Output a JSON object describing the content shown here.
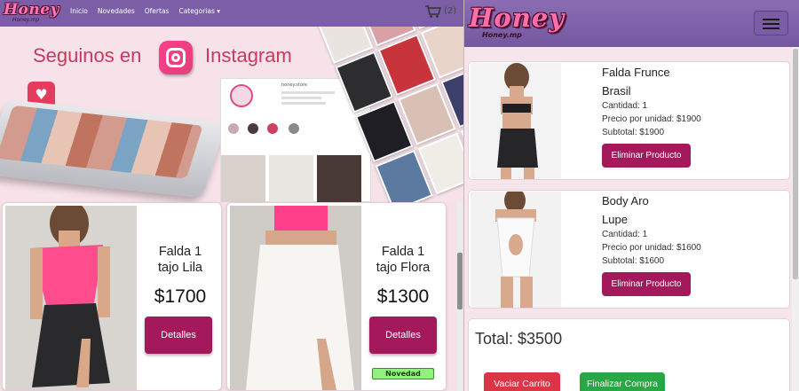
{
  "left": {
    "logo_text": "Honey",
    "logo_subtext": "Honey.mp",
    "nav": {
      "inicio": "Inicio",
      "novedades": "Novedades",
      "ofertas": "Ofertas",
      "categorias": "Categorias ▾"
    },
    "cart_count": "(2)",
    "hero": {
      "text_before": "Seguinos en",
      "text_after": "Instagram",
      "ig_handle": "honey.store"
    },
    "products": [
      {
        "name_line1": "Falda 1",
        "name_line2": "tajo Lila",
        "price": "$1700",
        "button": "Detalles",
        "badge": ""
      },
      {
        "name_line1": "Falda 1",
        "name_line2": "tajo Flora",
        "price": "$1300",
        "button": "Detalles",
        "badge": "Novedad"
      }
    ],
    "colors": {
      "navbar": "#7b5ea5",
      "accent": "#a3195b",
      "badge": "#92f07e",
      "hero_text": "#c7395e"
    }
  },
  "right": {
    "logo_text": "Honey",
    "logo_subtext": "Honey.mp",
    "menu_icon": "hamburger-icon",
    "cart_items": [
      {
        "name_line1": "Falda Frunce",
        "name_line2": "Brasil",
        "cantidad": "Cantidad: 1",
        "precio": "Precio por unidad: $1900",
        "subtotal": "Subtotal: $1900",
        "button": "Eliminar Producto"
      },
      {
        "name_line1": "Body Aro",
        "name_line2": "Lupe",
        "cantidad": "Cantidad: 1",
        "precio": "Precio por unidad: $1600",
        "subtotal": "Subtotal: $1600",
        "button": "Eliminar Producto"
      }
    ],
    "total": "Total: $3500",
    "vaciar": "Vaciar Carrito",
    "finalizar": "Finalizar Compra",
    "colors": {
      "danger": "#dc3545",
      "success": "#28a745",
      "accent": "#a3195b"
    }
  }
}
